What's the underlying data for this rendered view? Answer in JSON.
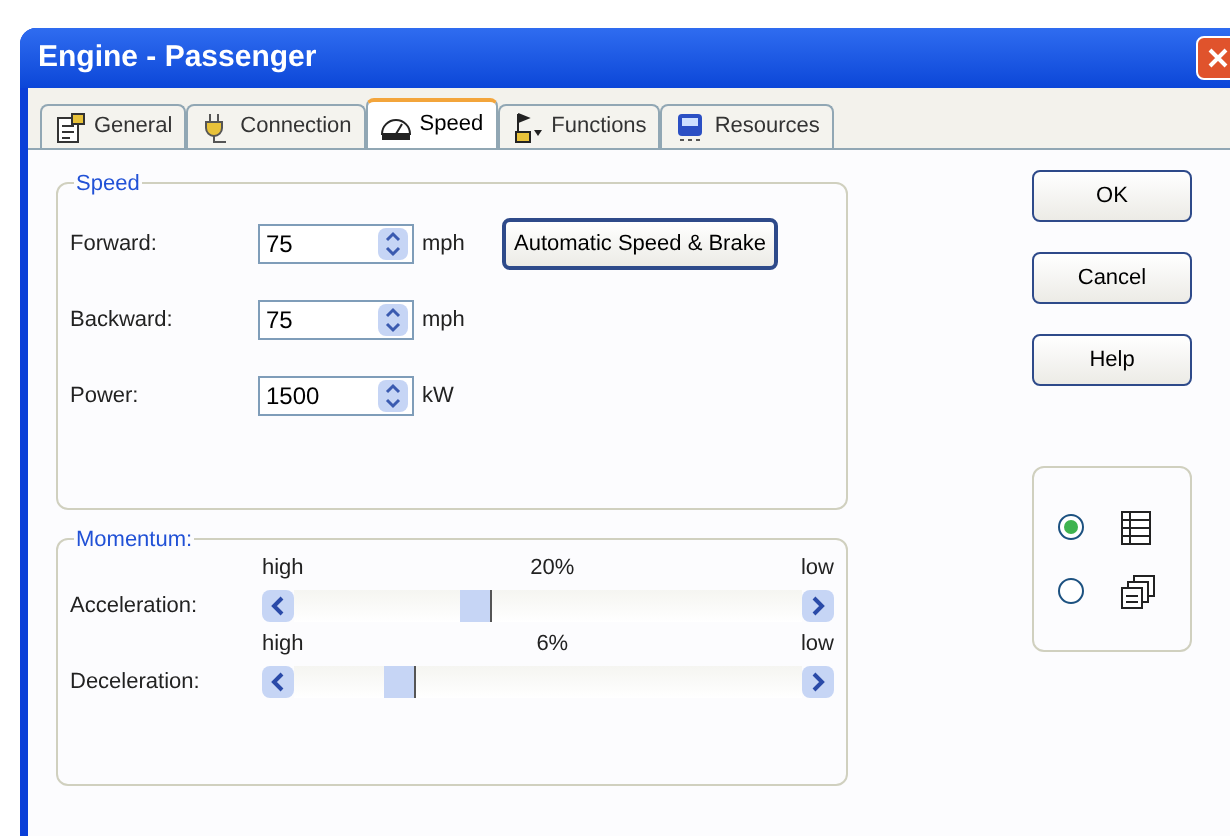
{
  "window": {
    "title": "Engine - Passenger"
  },
  "tabs": [
    {
      "label": "General",
      "selected": false
    },
    {
      "label": "Connection",
      "selected": false
    },
    {
      "label": "Speed",
      "selected": true
    },
    {
      "label": "Functions",
      "selected": false
    },
    {
      "label": "Resources",
      "selected": false
    }
  ],
  "speed": {
    "title": "Speed",
    "fields": [
      {
        "label": "Forward:",
        "value": "75",
        "unit": "mph"
      },
      {
        "label": "Backward:",
        "value": "75",
        "unit": "mph"
      },
      {
        "label": "Power:",
        "value": "1500",
        "unit": "kW"
      }
    ],
    "button": "Automatic Speed & Brake"
  },
  "momentum": {
    "title": "Momentum:",
    "sliders": [
      {
        "label": "Acceleration:",
        "left": "high",
        "reading": "20%",
        "right": "low",
        "level": 0.36
      },
      {
        "label": "Deceleration:",
        "left": "high",
        "reading": "6%",
        "right": "low",
        "level": 0.21
      }
    ]
  },
  "buttons": [
    "OK",
    "Cancel",
    "Help"
  ],
  "view_options": [
    {
      "selected": true
    },
    {
      "selected": false
    }
  ]
}
